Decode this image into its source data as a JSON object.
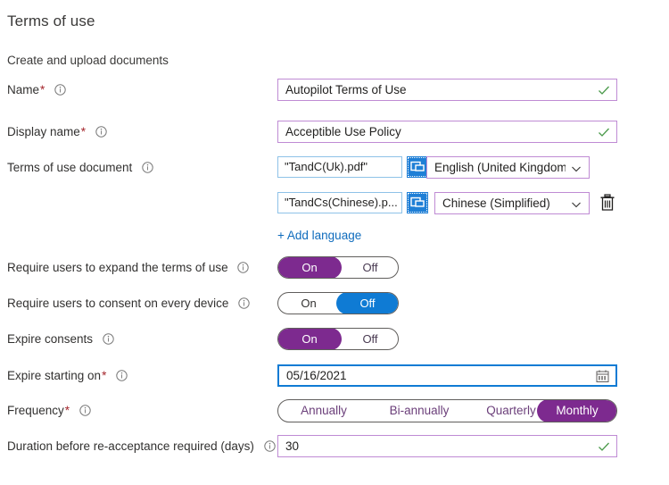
{
  "header": {
    "title": "Terms of use",
    "subtitle": "Create and upload documents"
  },
  "colors": {
    "accent_purple": "#7d2a8f",
    "accent_blue": "#0f7bd4",
    "required_red": "#a4262c",
    "link_blue": "#0f6cbd",
    "valid_green": "#4a9a4a",
    "input_border_purple": "#bf8bd4"
  },
  "form": {
    "name": {
      "label": "Name",
      "required": true,
      "info_icon": "info-icon",
      "value": "Autopilot Terms of Use",
      "valid_icon": "checkmark-icon"
    },
    "display_name": {
      "label": "Display name",
      "required": true,
      "info_icon": "info-icon",
      "value": "Acceptible Use Policy",
      "valid_icon": "checkmark-icon"
    },
    "terms_document": {
      "label": "Terms of use document",
      "required": false,
      "info_icon": "info-icon",
      "browse_icon": "folder-open-icon",
      "delete_icon": "trash-icon",
      "chevron_icon": "chevron-down-icon",
      "add_language_label": "+ Add language",
      "rows": [
        {
          "file_name": "\"TandC(Uk).pdf\"",
          "language": "English (United Kingdom)",
          "deletable": false
        },
        {
          "file_name": "\"TandCs(Chinese).p...",
          "language": "Chinese (Simplified)",
          "deletable": true
        }
      ]
    },
    "require_expand": {
      "label": "Require users to expand the terms of use",
      "required": false,
      "info_icon": "info-icon",
      "on_label": "On",
      "off_label": "Off",
      "selected": "On"
    },
    "require_consent_every_device": {
      "label": "Require users to consent on every device",
      "required": false,
      "info_icon": "info-icon",
      "on_label": "On",
      "off_label": "Off",
      "selected": "Off"
    },
    "expire_consents": {
      "label": "Expire consents",
      "required": false,
      "info_icon": "info-icon",
      "on_label": "On",
      "off_label": "Off",
      "selected": "On"
    },
    "expire_starting_on": {
      "label": "Expire starting on",
      "required": true,
      "info_icon": "info-icon",
      "value": "05/16/2021",
      "calendar_icon": "calendar-icon"
    },
    "frequency": {
      "label": "Frequency",
      "required": true,
      "info_icon": "info-icon",
      "options": [
        "Annually",
        "Bi-annually",
        "Quarterly",
        "Monthly"
      ],
      "selected": "Monthly"
    },
    "duration_before_reacceptance": {
      "label": "Duration before re-acceptance required (days)",
      "required": false,
      "info_icon": "info-icon",
      "value": "30",
      "valid_icon": "checkmark-icon"
    }
  }
}
